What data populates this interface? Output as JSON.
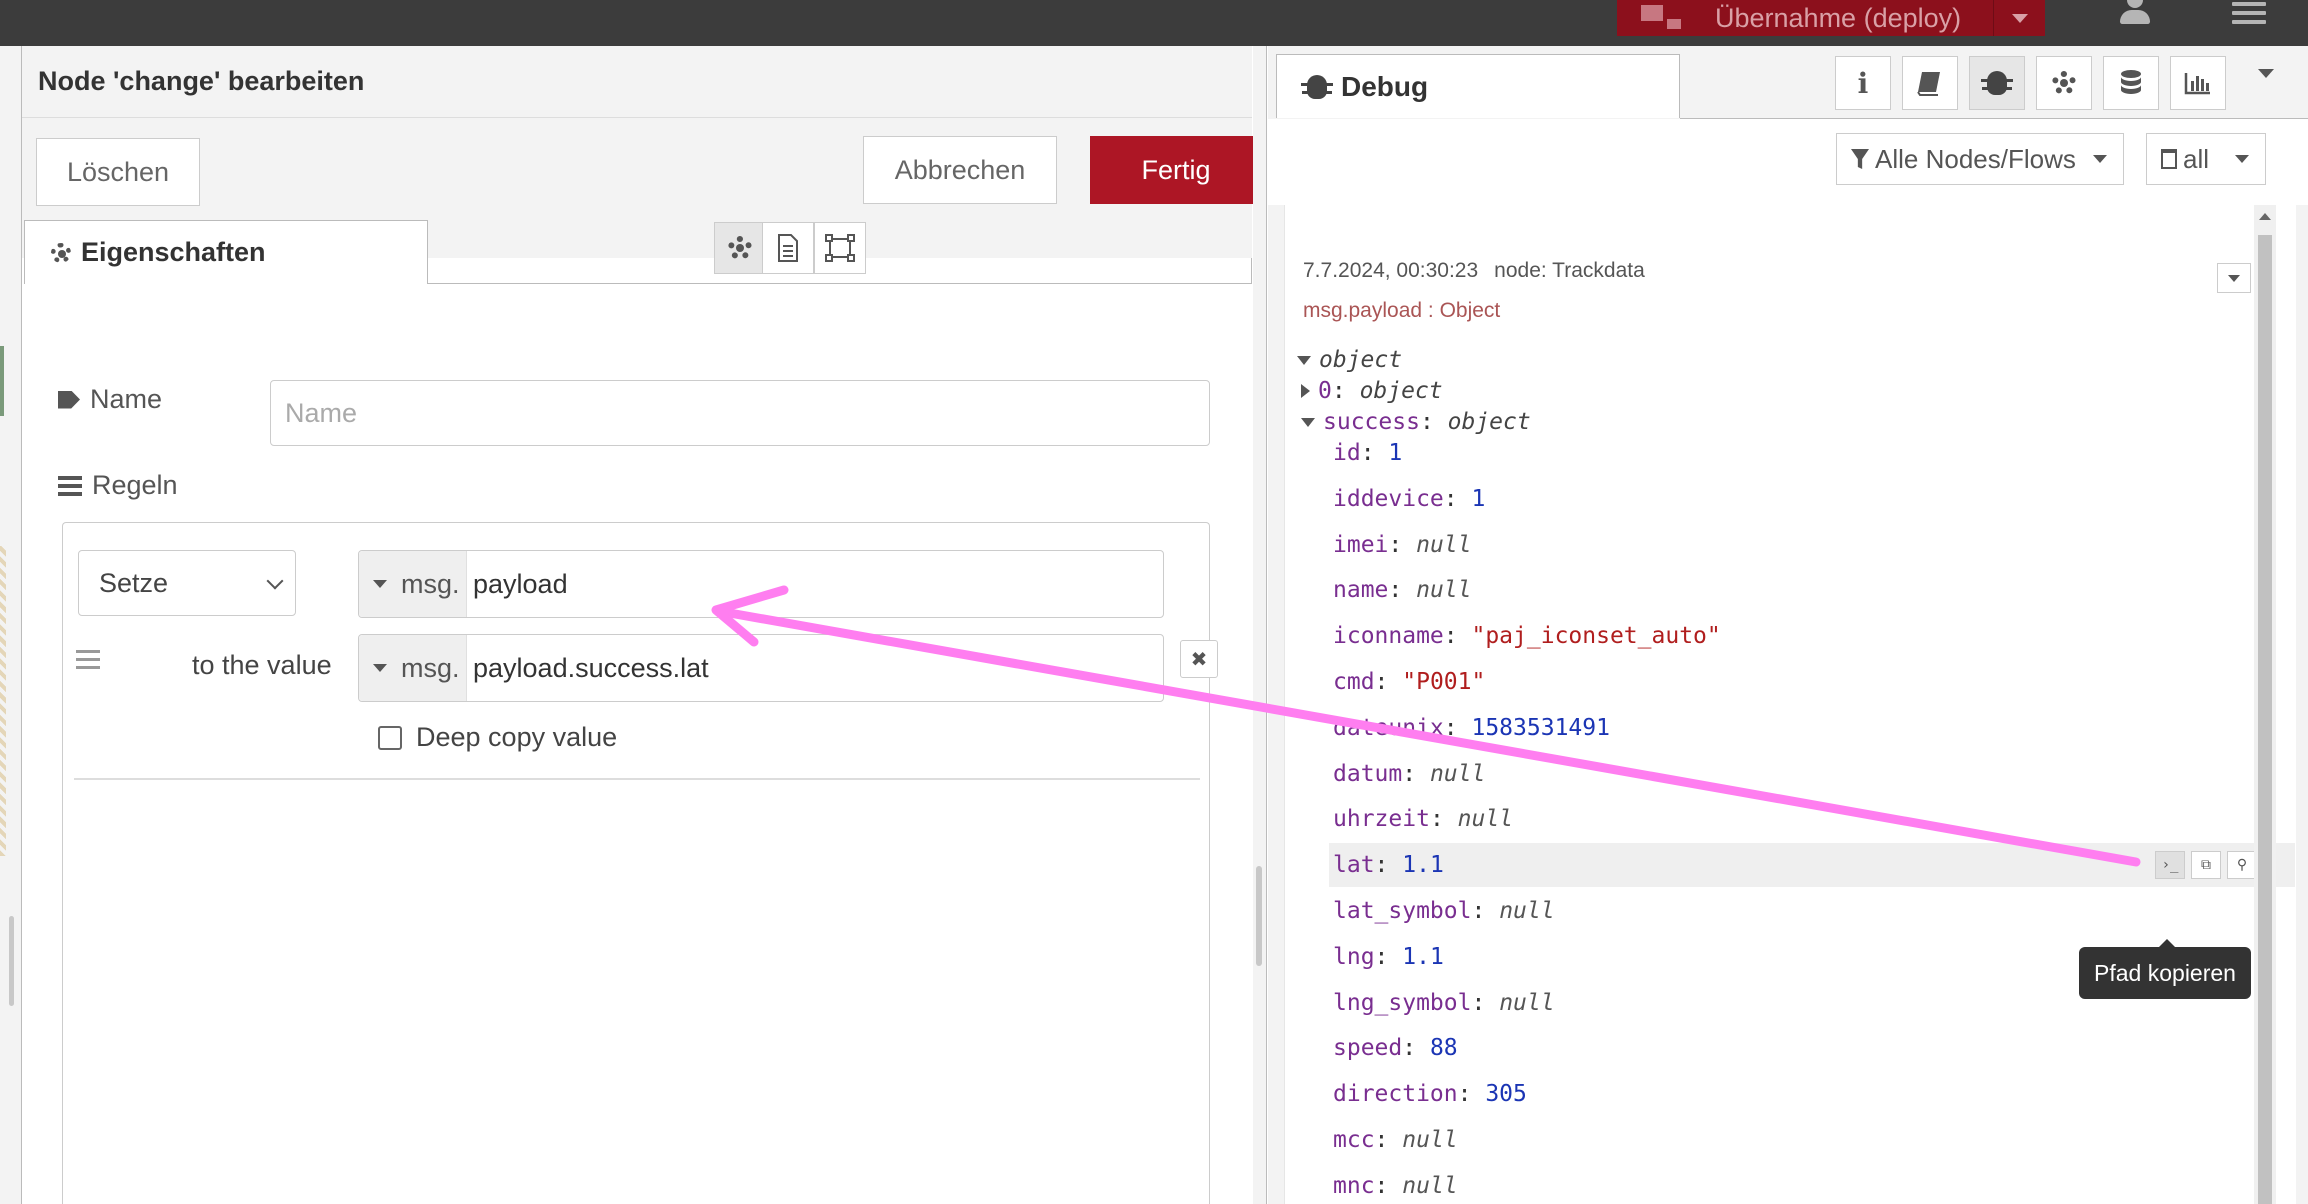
{
  "topbar": {
    "deploy_label": "Übernahme (deploy)"
  },
  "editor": {
    "title": "Node 'change' bearbeiten",
    "delete_label": "Löschen",
    "cancel_label": "Abbrechen",
    "done_label": "Fertig",
    "tab_properties": "Eigenschaften",
    "name_label": "Name",
    "name_placeholder": "Name",
    "rules_label": "Regeln",
    "rule": {
      "action": "Setze",
      "target_type": "msg.",
      "target_value": "payload",
      "to_label": "to the value",
      "source_type": "msg.",
      "source_value": "payload.success.lat",
      "deep_copy_label": "Deep copy value"
    }
  },
  "sidebar": {
    "tab_label": "Debug",
    "info_glyph": "i",
    "filter_label": "Alle Nodes/Flows",
    "clear_label": "all",
    "message": {
      "timestamp": "7.7.2024, 00:30:23",
      "node": "node: Trackdata",
      "topic": "msg.payload : Object",
      "root_type": "object",
      "item0_key": "0",
      "item0_type": "object",
      "success_key": "success",
      "success_type": "object",
      "fields": [
        {
          "key": "id",
          "value": "1",
          "kind": "n"
        },
        {
          "key": "iddevice",
          "value": "1",
          "kind": "n"
        },
        {
          "key": "imei",
          "value": "null",
          "kind": "nul"
        },
        {
          "key": "name",
          "value": "null",
          "kind": "nul"
        },
        {
          "key": "iconname",
          "value": "\"paj_iconset_auto\"",
          "kind": "s"
        },
        {
          "key": "cmd",
          "value": "\"P001\"",
          "kind": "s"
        },
        {
          "key": "dateunix",
          "value": "1583531491",
          "kind": "n"
        },
        {
          "key": "datum",
          "value": "null",
          "kind": "nul"
        },
        {
          "key": "uhrzeit",
          "value": "null",
          "kind": "nul"
        },
        {
          "key": "lat",
          "value": "1.1",
          "kind": "n"
        },
        {
          "key": "lat_symbol",
          "value": "null",
          "kind": "nul"
        },
        {
          "key": "lng",
          "value": "1.1",
          "kind": "n"
        },
        {
          "key": "lng_symbol",
          "value": "null",
          "kind": "nul"
        },
        {
          "key": "speed",
          "value": "88",
          "kind": "n"
        },
        {
          "key": "direction",
          "value": "305",
          "kind": "n"
        },
        {
          "key": "mcc",
          "value": "null",
          "kind": "nul"
        },
        {
          "key": "mnc",
          "value": "null",
          "kind": "nul"
        }
      ],
      "tooltip": "Pfad kopieren"
    }
  },
  "colors": {
    "done_button": "#ad1625",
    "deploy_button": "#8c101c",
    "annotation_arrow": "#ff7ef0",
    "key_color": "#792e90",
    "number_color": "#1b35b4",
    "string_color": "#b01e1e"
  },
  "icons": [
    "gear-icon",
    "document-icon",
    "frame-icon",
    "tag-icon",
    "list-icon",
    "bug-icon",
    "book-icon",
    "database-icon",
    "chart-icon",
    "filter-icon",
    "trash-icon",
    "user-icon",
    "menu-icon",
    "copy-path-icon",
    "copy-value-icon",
    "pin-icon"
  ]
}
